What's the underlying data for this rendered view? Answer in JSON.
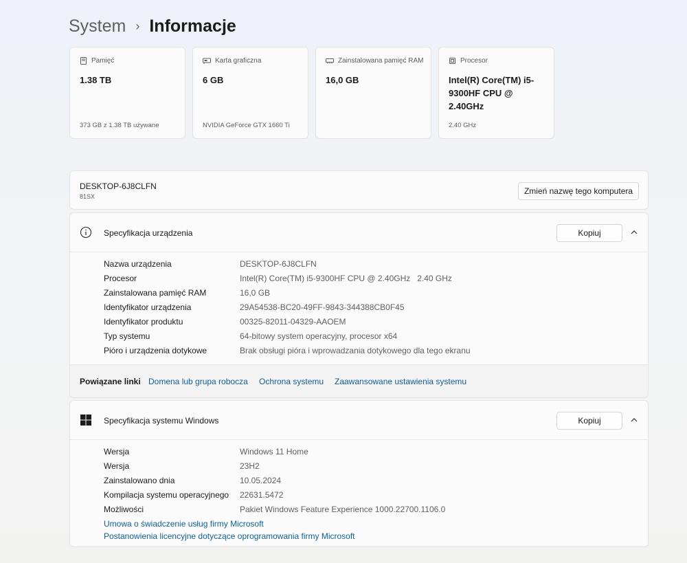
{
  "breadcrumb": {
    "parent": "System",
    "separator": "›",
    "current": "Informacje"
  },
  "cards": [
    {
      "icon": "storage-icon",
      "title": "Pamięć",
      "value": "1.38 TB",
      "sub": "373 GB z 1.38 TB używane"
    },
    {
      "icon": "graphics-card-icon",
      "title": "Karta graficzna",
      "value": "6 GB",
      "sub": "NVIDIA GeForce GTX 1660 Ti"
    },
    {
      "icon": "ram-icon",
      "title": "Zainstalowana pamięć RAM",
      "value": "16,0 GB",
      "sub": ""
    },
    {
      "icon": "processor-icon",
      "title": "Procesor",
      "value": "Intel(R) Core(TM) i5-9300HF CPU @ 2.40GHz",
      "sub": "2.40 GHz"
    }
  ],
  "computer": {
    "name": "DESKTOP-6J8CLFN",
    "model": "81SX",
    "rename_label": "Zmień nazwę tego komputera"
  },
  "device_spec": {
    "title": "Specyfikacja urządzenia",
    "copy_label": "Kopiuj",
    "rows": [
      {
        "label": "Nazwa urządzenia",
        "value": "DESKTOP-6J8CLFN"
      },
      {
        "label": "Procesor",
        "value": "Intel(R) Core(TM) i5-9300HF CPU @ 2.40GHz   2.40 GHz"
      },
      {
        "label": "Zainstalowana pamięć RAM",
        "value": "16,0 GB"
      },
      {
        "label": "Identyfikator urządzenia",
        "value": "29A54538-BC20-49FF-9843-344388CB0F45"
      },
      {
        "label": "Identyfikator produktu",
        "value": "00325-82011-04329-AAOEM"
      },
      {
        "label": "Typ systemu",
        "value": "64-bitowy system operacyjny, procesor x64"
      },
      {
        "label": "Pióro i urządzenia dotykowe",
        "value": "Brak obsługi pióra i wprowadzania dotykowego dla tego ekranu"
      }
    ]
  },
  "related_links": {
    "label": "Powiązane linki",
    "links": [
      "Domena lub grupa robocza",
      "Ochrona systemu",
      "Zaawansowane ustawienia systemu"
    ]
  },
  "windows_spec": {
    "title": "Specyfikacja systemu Windows",
    "copy_label": "Kopiuj",
    "rows": [
      {
        "label": "Wersja",
        "value": "Windows 11 Home"
      },
      {
        "label": "Wersja",
        "value": "23H2"
      },
      {
        "label": "Zainstalowano dnia",
        "value": "10.05.2024"
      },
      {
        "label": "Kompilacja systemu operacyjnego",
        "value": "22631.5472"
      },
      {
        "label": "Możliwości",
        "value": "Pakiet Windows Feature Experience 1000.22700.1106.0"
      }
    ],
    "links": [
      "Umowa o świadczenie usług firmy Microsoft",
      "Postanowienia licencyjne dotyczące oprogramowania firmy Microsoft"
    ]
  },
  "colors": {
    "link": "#0f5f96",
    "panel_bg": "#fbfbfb",
    "links_bar_bg": "#f3f3f3"
  }
}
